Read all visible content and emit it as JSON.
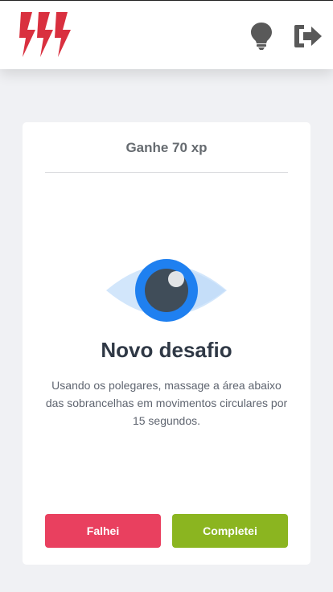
{
  "header": {
    "logo_icon": "lightning-bolts-logo",
    "logo_color": "#d9303f",
    "tip_icon": "lightbulb-icon",
    "logout_icon": "logout-icon",
    "icon_color": "#595959"
  },
  "challenge": {
    "xp_label": "Ganhe 70 xp",
    "illustration": "eye-icon",
    "title": "Novo desafio",
    "description": "Usando os polegares, massage a área abaixo das sobrancelhas em movimentos circulares por 15 segundos.",
    "fail_label": "Falhei",
    "complete_label": "Completei",
    "fail_color": "#e9405f",
    "complete_color": "#8bb520"
  }
}
